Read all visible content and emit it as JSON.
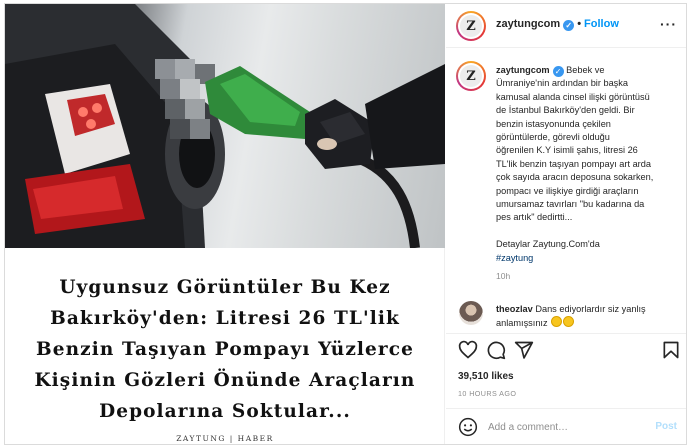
{
  "post": {
    "headline_lines": [
      "Uygunsuz Görüntüler Bu Kez",
      "Bakırköy'den: Litresi 26 TL'lik",
      "Benzin Taşıyan Pompayı Yüzlerce",
      "Kişinin Gözleri Önünde Araçların",
      "Depolarına Soktular..."
    ],
    "credit": "ZAYTUNG | HABER"
  },
  "header": {
    "avatar_letter": "Z",
    "username": "zaytungcom",
    "verified_icon": "verified-badge-icon",
    "separator": "•",
    "follow_label": "Follow",
    "more_label": "···"
  },
  "caption": {
    "username": "zaytungcom",
    "text_lines": [
      "Bebek ve",
      "Ümraniye'nin ardından bir başka",
      "kamusal alanda cinsel ilişki görüntüsü",
      "de İstanbul Bakırköy'den geldi. Bir",
      "benzin istasyonunda çekilen",
      "görüntülerde, görevli olduğu",
      "öğrenilen K.Y isimli şahıs, litresi 26",
      "TL'lik benzin taşıyan pompayı art arda",
      "çok sayıda aracın deposuna sokarken,",
      "pompacı ve ilişkiye girdiği araçların",
      "umursamaz tavırları \"bu kadarına da",
      "pes artık\" dedirtti..."
    ],
    "details": "Detaylar Zaytung.Com'da",
    "hashtag": "#zaytung",
    "time": "10h"
  },
  "comment": {
    "username": "theozlav",
    "text": "Dans ediyorlardır siz yanlış",
    "text2": "anlamışsınız"
  },
  "actions": {
    "icons": [
      "heart-icon",
      "comment-icon",
      "share-icon",
      "bookmark-icon"
    ],
    "likes": "39,510 likes",
    "ago": "10 HOURS AGO"
  },
  "add_comment": {
    "placeholder": "Add a comment…",
    "post_label": "Post"
  },
  "colors": {
    "accent": "#0095f6",
    "verified": "#3897f0",
    "muted": "#8e8e8e"
  }
}
